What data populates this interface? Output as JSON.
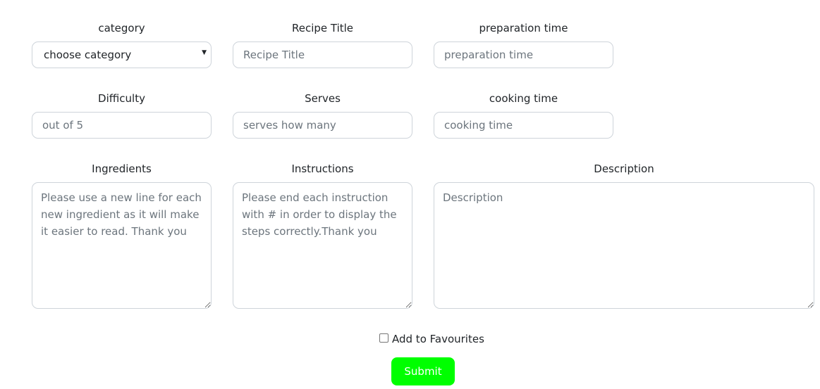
{
  "form": {
    "category": {
      "label": "category",
      "selected": "choose category"
    },
    "recipe_title": {
      "label": "Recipe Title",
      "placeholder": "Recipe Title"
    },
    "preparation_time": {
      "label": "preparation time",
      "placeholder": "preparation time"
    },
    "difficulty": {
      "label": "Difficulty",
      "placeholder": "out of 5"
    },
    "serves": {
      "label": "Serves",
      "placeholder": "serves how many"
    },
    "cooking_time": {
      "label": "cooking time",
      "placeholder": "cooking time"
    },
    "ingredients": {
      "label": "Ingredients",
      "placeholder": "Please use a new line for each new ingredient as it will make it easier to read. Thank you"
    },
    "instructions": {
      "label": "Instructions",
      "placeholder": "Please end each instruction with # in order to display the steps correctly.Thank you"
    },
    "description": {
      "label": "Description",
      "placeholder": "Description"
    },
    "favourites": {
      "label": "Add to Favourites",
      "checked": false
    },
    "submit_label": "Submit"
  },
  "colors": {
    "submit_bg": "#00ff00",
    "submit_text": "#ffffff",
    "border": "#ced4da",
    "placeholder": "#6c757d"
  },
  "icons": {
    "select_caret": "chevron-down-icon"
  }
}
